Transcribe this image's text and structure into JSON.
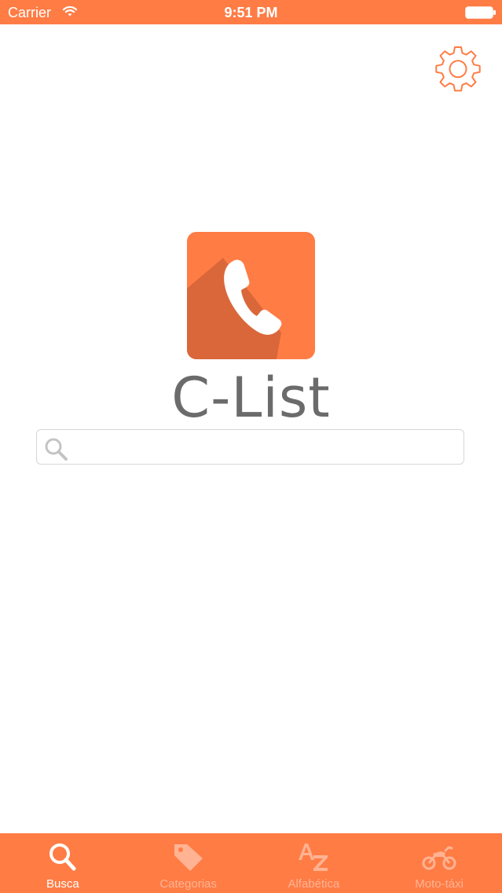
{
  "status_bar": {
    "carrier": "Carrier",
    "time": "9:51 PM",
    "wifi_icon": "wifi-icon",
    "battery_icon": "battery-icon"
  },
  "settings": {
    "icon": "gear-icon"
  },
  "logo": {
    "icon": "phone-icon",
    "app_name": "C-List"
  },
  "search": {
    "icon": "search-icon",
    "value": "",
    "placeholder": ""
  },
  "tab_bar": {
    "tabs": [
      {
        "label": "Busca",
        "icon": "search-icon",
        "active": true
      },
      {
        "label": "Categorias",
        "icon": "tag-icon",
        "active": false
      },
      {
        "label": "Alfabética",
        "icon": "alphabet-az-icon",
        "active": false
      },
      {
        "label": "Moto-táxi",
        "icon": "motorcycle-icon",
        "active": false
      }
    ]
  },
  "colors": {
    "accent": "#ff7c45",
    "text_gray": "#6b6b6b",
    "border": "#d7d7d7"
  }
}
